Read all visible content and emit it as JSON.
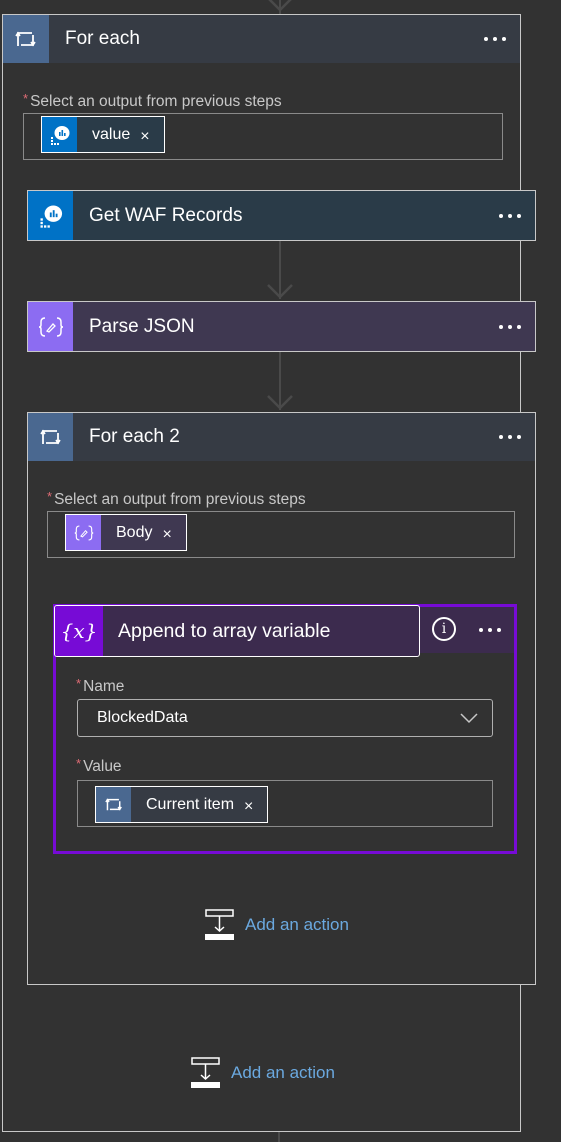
{
  "colors": {
    "loop_blue": "#4a6890",
    "header_dark": "#363b44",
    "connector_blue": "#0072c6",
    "connector_header": "#2a3b48",
    "parse_purple": "#8c6cf2",
    "parse_header": "#3f3851",
    "variable_purple": "#770bd6",
    "variable_header": "#3c2b4e",
    "link_blue": "#6ba9e0",
    "required_red": "#e06c75"
  },
  "for_each": {
    "title": "For each",
    "icon": "loop-icon",
    "field_label": "Select an output from previous steps",
    "token": {
      "label": "value",
      "icon": "application-insights-icon",
      "close": "×"
    }
  },
  "get_waf_records": {
    "title": "Get WAF Records",
    "icon": "application-insights-icon"
  },
  "parse_json": {
    "title": "Parse JSON",
    "icon": "parse-json-icon"
  },
  "for_each_2": {
    "title": "For each 2",
    "icon": "loop-icon",
    "field_label": "Select an output from previous steps",
    "token": {
      "label": "Body",
      "icon": "parse-json-icon",
      "close": "×"
    }
  },
  "append_to_array": {
    "title": "Append to array variable",
    "icon": "variable-icon",
    "icon_glyph": "{x}",
    "name_label": "Name",
    "name_value": "BlockedData",
    "value_label": "Value",
    "value_token": {
      "label": "Current item",
      "icon": "loop-icon",
      "close": "×"
    }
  },
  "add_action_inner": {
    "label": "Add an action"
  },
  "add_action_outer": {
    "label": "Add an action"
  },
  "required_marker": "*"
}
